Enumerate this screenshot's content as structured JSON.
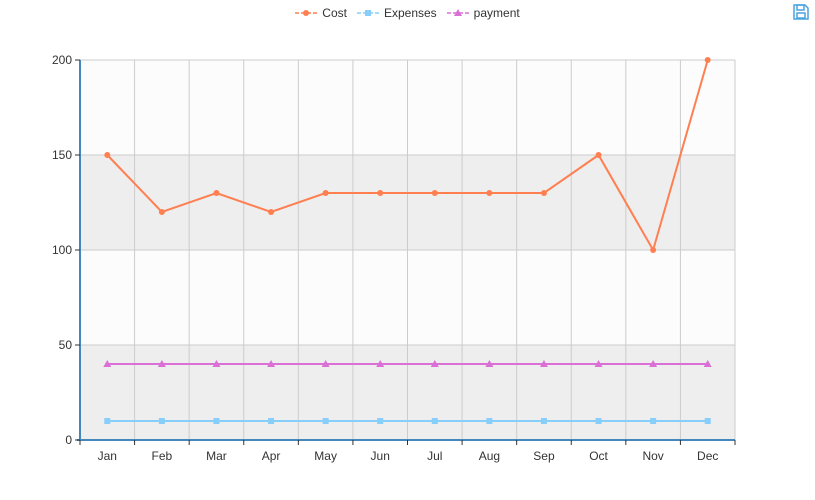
{
  "toolbox": {
    "save_icon": "save-as-image-icon",
    "accent": "#4aa3df"
  },
  "chart_data": {
    "type": "line",
    "categories": [
      "Jan",
      "Feb",
      "Mar",
      "Apr",
      "May",
      "Jun",
      "Jul",
      "Aug",
      "Sep",
      "Oct",
      "Nov",
      "Dec"
    ],
    "series": [
      {
        "name": "Cost",
        "color": "#ff7f50",
        "marker": "circle",
        "values": [
          150,
          120,
          130,
          120,
          130,
          130,
          130,
          130,
          130,
          150,
          100,
          200
        ]
      },
      {
        "name": "Expenses",
        "color": "#87cefa",
        "marker": "square",
        "values": [
          10,
          10,
          10,
          10,
          10,
          10,
          10,
          10,
          10,
          10,
          10,
          10
        ]
      },
      {
        "name": "payment",
        "color": "#da70d6",
        "marker": "triangle",
        "values": [
          40,
          40,
          40,
          40,
          40,
          40,
          40,
          40,
          40,
          40,
          40,
          40
        ]
      }
    ],
    "ylim": [
      0,
      200
    ],
    "yticks": [
      0,
      50,
      100,
      150,
      200
    ],
    "grid": true,
    "legend_position": "top-center",
    "band_colors": [
      "#eeeeee",
      "#fcfcfc"
    ],
    "axis_color": "#4488bb"
  }
}
